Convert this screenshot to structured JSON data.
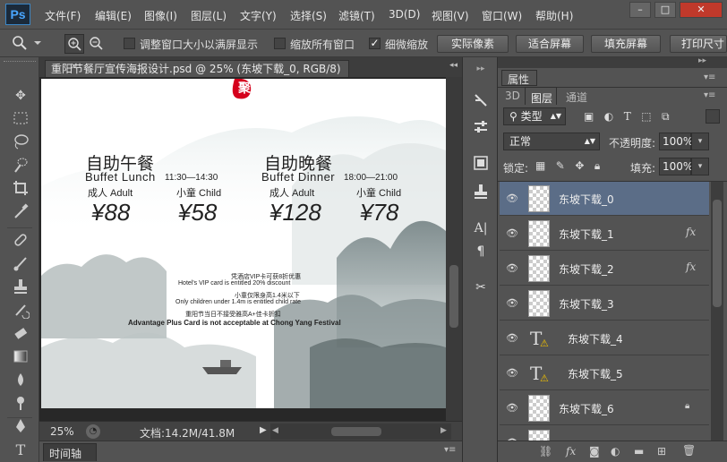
{
  "app": {
    "logo": "Ps"
  },
  "menubar": {
    "items": [
      "文件(F)",
      "编辑(E)",
      "图像(I)",
      "图层(L)",
      "文字(Y)",
      "选择(S)",
      "滤镜(T)",
      "3D(D)",
      "视图(V)",
      "窗口(W)",
      "帮助(H)"
    ],
    "win_min": "–",
    "win_max": "□",
    "win_close": "✕"
  },
  "options": {
    "resize_windows": "调整窗口大小以满屏显示",
    "zoom_all": "缩放所有窗口",
    "scrubby_zoom": "细微缩放",
    "scrubby_checked": true,
    "actual_pixels": "实际像素",
    "fit_screen": "适合屏幕",
    "fill_screen": "填充屏幕",
    "print_size": "打印尺寸"
  },
  "document": {
    "tab_title": "重阳节餐厅宣传海报设计.psd @ 25% (东坡下载_0, RGB/8)",
    "tab_close": "×"
  },
  "poster": {
    "top_char": "聚",
    "lunch_title": "自助午餐",
    "lunch_en": "Buffet Lunch",
    "lunch_time": "11:30—14:30",
    "dinner_title": "自助晚餐",
    "dinner_en": "Buffet Dinner",
    "dinner_time": "18:00—21:00",
    "adult_label": "成人 Adult",
    "child_label": "小童 Child",
    "lunch_adult_price": "¥88",
    "lunch_child_price": "¥58",
    "dinner_adult_price": "¥128",
    "dinner_child_price": "¥78",
    "note1_cn": "凭酒店VIP卡可获8折优惠",
    "note1_en": "Hotel's VIP card is entitled 20% discount",
    "note2_cn": "小童仅限身高1.4米以下",
    "note2_en": "Only children under 1.4m is entitled child rate",
    "note3_cn": "重阳节当日不接受雅高A+佳卡折扣",
    "note3_en": "Advantage Plus Card is not acceptable at Chong Yang Festival"
  },
  "status": {
    "zoom": "25%",
    "doc_info": "文档:14.2M/41.8M"
  },
  "timeline": {
    "label": "时间轴"
  },
  "panel": {
    "properties_tab": "属性",
    "tabs": [
      "3D",
      "图层",
      "通道"
    ],
    "filter_kind": "类型",
    "blend_mode": "正常",
    "opacity_label": "不透明度:",
    "opacity_value": "100%",
    "lock_label": "锁定:",
    "fill_label": "填充:",
    "fill_value": "100%"
  },
  "layers": [
    {
      "name": "东坡下载_0",
      "type": "pixel",
      "fx": false,
      "locked": false,
      "selected": true
    },
    {
      "name": "东坡下载_1",
      "type": "pixel",
      "fx": true,
      "locked": false,
      "selected": false
    },
    {
      "name": "东坡下载_2",
      "type": "pixel",
      "fx": true,
      "locked": false,
      "selected": false
    },
    {
      "name": "东坡下载_3",
      "type": "pixel",
      "fx": false,
      "locked": false,
      "selected": false
    },
    {
      "name": "东坡下载_4",
      "type": "text",
      "fx": false,
      "locked": false,
      "selected": false
    },
    {
      "name": "东坡下载_5",
      "type": "text",
      "fx": false,
      "locked": false,
      "selected": false
    },
    {
      "name": "东坡下载_6",
      "type": "pixel",
      "fx": false,
      "locked": true,
      "selected": false
    }
  ],
  "icons": {
    "fx": "fx",
    "eye": "●"
  }
}
